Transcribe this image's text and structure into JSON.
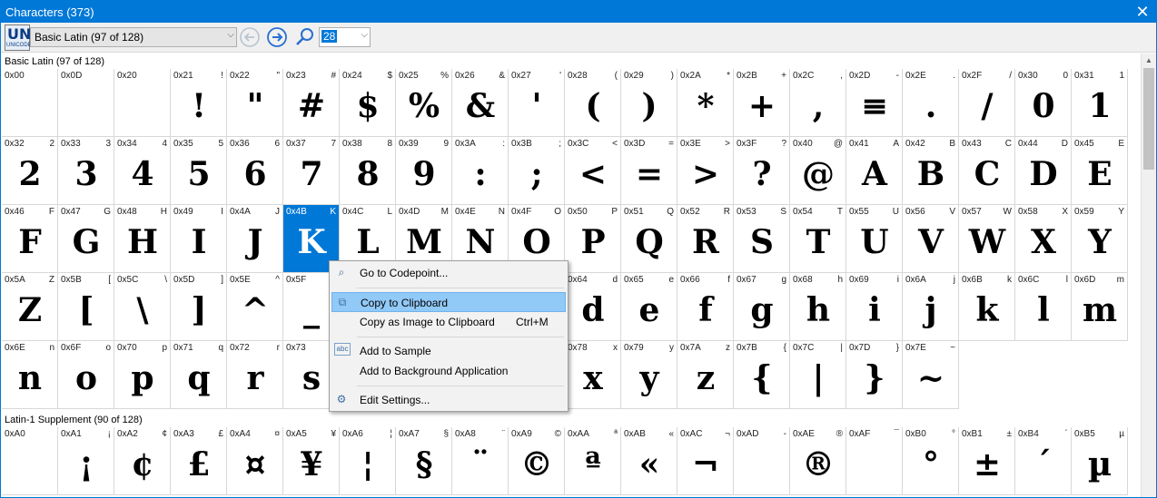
{
  "window": {
    "title": "Characters (373)",
    "close_glyph": "✕"
  },
  "toolbar": {
    "logo": {
      "text_top": "UN",
      "text_bottom": "UNICODE"
    },
    "block_select": "Basic Latin (97 of 128)",
    "size_select": "28",
    "back_icon": "back-arrow-icon",
    "forward_icon": "forward-arrow-icon",
    "search_icon": "search-icon"
  },
  "sections": [
    {
      "header": "Basic Latin (97 of 128)",
      "cells": [
        {
          "code": "0x00",
          "mini": "",
          "glyph": ""
        },
        {
          "code": "0x0D",
          "mini": "",
          "glyph": ""
        },
        {
          "code": "0x20",
          "mini": "",
          "glyph": ""
        },
        {
          "code": "0x21",
          "mini": "!",
          "glyph": "!"
        },
        {
          "code": "0x22",
          "mini": "\"",
          "glyph": "\""
        },
        {
          "code": "0x23",
          "mini": "#",
          "glyph": "#"
        },
        {
          "code": "0x24",
          "mini": "$",
          "glyph": "$"
        },
        {
          "code": "0x25",
          "mini": "%",
          "glyph": "%"
        },
        {
          "code": "0x26",
          "mini": "&",
          "glyph": "&"
        },
        {
          "code": "0x27",
          "mini": "'",
          "glyph": "'"
        },
        {
          "code": "0x28",
          "mini": "(",
          "glyph": "("
        },
        {
          "code": "0x29",
          "mini": ")",
          "glyph": ")"
        },
        {
          "code": "0x2A",
          "mini": "*",
          "glyph": "*"
        },
        {
          "code": "0x2B",
          "mini": "+",
          "glyph": "+"
        },
        {
          "code": "0x2C",
          "mini": ",",
          "glyph": ","
        },
        {
          "code": "0x2D",
          "mini": "-",
          "glyph": "≡"
        },
        {
          "code": "0x2E",
          "mini": ".",
          "glyph": "."
        },
        {
          "code": "0x2F",
          "mini": "/",
          "glyph": "/"
        },
        {
          "code": "0x30",
          "mini": "0",
          "glyph": "0"
        },
        {
          "code": "0x31",
          "mini": "1",
          "glyph": "1"
        },
        {
          "code": "0x32",
          "mini": "2",
          "glyph": "2"
        },
        {
          "code": "0x33",
          "mini": "3",
          "glyph": "3"
        },
        {
          "code": "0x34",
          "mini": "4",
          "glyph": "4"
        },
        {
          "code": "0x35",
          "mini": "5",
          "glyph": "5"
        },
        {
          "code": "0x36",
          "mini": "6",
          "glyph": "6"
        },
        {
          "code": "0x37",
          "mini": "7",
          "glyph": "7"
        },
        {
          "code": "0x38",
          "mini": "8",
          "glyph": "8"
        },
        {
          "code": "0x39",
          "mini": "9",
          "glyph": "9"
        },
        {
          "code": "0x3A",
          "mini": ":",
          "glyph": ":"
        },
        {
          "code": "0x3B",
          "mini": ";",
          "glyph": ";"
        },
        {
          "code": "0x3C",
          "mini": "<",
          "glyph": "<"
        },
        {
          "code": "0x3D",
          "mini": "=",
          "glyph": "="
        },
        {
          "code": "0x3E",
          "mini": ">",
          "glyph": ">"
        },
        {
          "code": "0x3F",
          "mini": "?",
          "glyph": "?"
        },
        {
          "code": "0x40",
          "mini": "@",
          "glyph": "@"
        },
        {
          "code": "0x41",
          "mini": "A",
          "glyph": "A"
        },
        {
          "code": "0x42",
          "mini": "B",
          "glyph": "B"
        },
        {
          "code": "0x43",
          "mini": "C",
          "glyph": "C"
        },
        {
          "code": "0x44",
          "mini": "D",
          "glyph": "D"
        },
        {
          "code": "0x45",
          "mini": "E",
          "glyph": "E"
        },
        {
          "code": "0x46",
          "mini": "F",
          "glyph": "F"
        },
        {
          "code": "0x47",
          "mini": "G",
          "glyph": "G"
        },
        {
          "code": "0x48",
          "mini": "H",
          "glyph": "H"
        },
        {
          "code": "0x49",
          "mini": "I",
          "glyph": "I"
        },
        {
          "code": "0x4A",
          "mini": "J",
          "glyph": "J"
        },
        {
          "code": "0x4B",
          "mini": "K",
          "glyph": "K",
          "selected": true
        },
        {
          "code": "0x4C",
          "mini": "L",
          "glyph": "L"
        },
        {
          "code": "0x4D",
          "mini": "M",
          "glyph": "M"
        },
        {
          "code": "0x4E",
          "mini": "N",
          "glyph": "N"
        },
        {
          "code": "0x4F",
          "mini": "O",
          "glyph": "O"
        },
        {
          "code": "0x50",
          "mini": "P",
          "glyph": "P"
        },
        {
          "code": "0x51",
          "mini": "Q",
          "glyph": "Q"
        },
        {
          "code": "0x52",
          "mini": "R",
          "glyph": "R"
        },
        {
          "code": "0x53",
          "mini": "S",
          "glyph": "S"
        },
        {
          "code": "0x54",
          "mini": "T",
          "glyph": "T"
        },
        {
          "code": "0x55",
          "mini": "U",
          "glyph": "U"
        },
        {
          "code": "0x56",
          "mini": "V",
          "glyph": "V"
        },
        {
          "code": "0x57",
          "mini": "W",
          "glyph": "W"
        },
        {
          "code": "0x58",
          "mini": "X",
          "glyph": "X"
        },
        {
          "code": "0x59",
          "mini": "Y",
          "glyph": "Y"
        },
        {
          "code": "0x5A",
          "mini": "Z",
          "glyph": "Z"
        },
        {
          "code": "0x5B",
          "mini": "[",
          "glyph": "["
        },
        {
          "code": "0x5C",
          "mini": "\\",
          "glyph": "\\"
        },
        {
          "code": "0x5D",
          "mini": "]",
          "glyph": "]"
        },
        {
          "code": "0x5E",
          "mini": "^",
          "glyph": "^"
        },
        {
          "code": "0x5F",
          "mini": "",
          "glyph": "_"
        },
        {
          "code": "",
          "mini": "",
          "glyph": ""
        },
        {
          "code": "",
          "mini": "",
          "glyph": ""
        },
        {
          "code": "",
          "mini": "",
          "glyph": ""
        },
        {
          "code": "",
          "mini": "",
          "glyph": ""
        },
        {
          "code": "0x64",
          "mini": "d",
          "glyph": "d"
        },
        {
          "code": "0x65",
          "mini": "e",
          "glyph": "e"
        },
        {
          "code": "0x66",
          "mini": "f",
          "glyph": "f"
        },
        {
          "code": "0x67",
          "mini": "g",
          "glyph": "g"
        },
        {
          "code": "0x68",
          "mini": "h",
          "glyph": "h"
        },
        {
          "code": "0x69",
          "mini": "i",
          "glyph": "i"
        },
        {
          "code": "0x6A",
          "mini": "j",
          "glyph": "j"
        },
        {
          "code": "0x6B",
          "mini": "k",
          "glyph": "k"
        },
        {
          "code": "0x6C",
          "mini": "l",
          "glyph": "l"
        },
        {
          "code": "0x6D",
          "mini": "m",
          "glyph": "m"
        },
        {
          "code": "0x6E",
          "mini": "n",
          "glyph": "n"
        },
        {
          "code": "0x6F",
          "mini": "o",
          "glyph": "o"
        },
        {
          "code": "0x70",
          "mini": "p",
          "glyph": "p"
        },
        {
          "code": "0x71",
          "mini": "q",
          "glyph": "q"
        },
        {
          "code": "0x72",
          "mini": "r",
          "glyph": "r"
        },
        {
          "code": "0x73",
          "mini": "",
          "glyph": "s"
        },
        {
          "code": "",
          "mini": "",
          "glyph": ""
        },
        {
          "code": "",
          "mini": "",
          "glyph": ""
        },
        {
          "code": "",
          "mini": "",
          "glyph": ""
        },
        {
          "code": "",
          "mini": "",
          "glyph": ""
        },
        {
          "code": "0x78",
          "mini": "x",
          "glyph": "x"
        },
        {
          "code": "0x79",
          "mini": "y",
          "glyph": "y"
        },
        {
          "code": "0x7A",
          "mini": "z",
          "glyph": "z"
        },
        {
          "code": "0x7B",
          "mini": "{",
          "glyph": "{"
        },
        {
          "code": "0x7C",
          "mini": "|",
          "glyph": "|"
        },
        {
          "code": "0x7D",
          "mini": "}",
          "glyph": "}"
        },
        {
          "code": "0x7E",
          "mini": "~",
          "glyph": "~"
        }
      ]
    },
    {
      "header": "Latin-1 Supplement (90 of 128)",
      "cells": [
        {
          "code": "0xA0",
          "mini": "",
          "glyph": ""
        },
        {
          "code": "0xA1",
          "mini": "¡",
          "glyph": "¡"
        },
        {
          "code": "0xA2",
          "mini": "¢",
          "glyph": "¢"
        },
        {
          "code": "0xA3",
          "mini": "£",
          "glyph": "£"
        },
        {
          "code": "0xA4",
          "mini": "¤",
          "glyph": "¤"
        },
        {
          "code": "0xA5",
          "mini": "¥",
          "glyph": "¥"
        },
        {
          "code": "0xA6",
          "mini": "¦",
          "glyph": "¦"
        },
        {
          "code": "0xA7",
          "mini": "§",
          "glyph": "§"
        },
        {
          "code": "0xA8",
          "mini": "¨",
          "glyph": "¨"
        },
        {
          "code": "0xA9",
          "mini": "©",
          "glyph": "©"
        },
        {
          "code": "0xAA",
          "mini": "ª",
          "glyph": "ª"
        },
        {
          "code": "0xAB",
          "mini": "«",
          "glyph": "«"
        },
        {
          "code": "0xAC",
          "mini": "¬",
          "glyph": "¬"
        },
        {
          "code": "0xAD",
          "mini": "-",
          "glyph": ""
        },
        {
          "code": "0xAE",
          "mini": "®",
          "glyph": "®"
        },
        {
          "code": "0xAF",
          "mini": "¯",
          "glyph": ""
        },
        {
          "code": "0xB0",
          "mini": "°",
          "glyph": "°"
        },
        {
          "code": "0xB1",
          "mini": "±",
          "glyph": "±"
        },
        {
          "code": "0xB4",
          "mini": "´",
          "glyph": "´"
        },
        {
          "code": "0xB5",
          "mini": "µ",
          "glyph": "µ"
        }
      ]
    }
  ],
  "context_menu": {
    "items": [
      {
        "label": "Go to Codepoint...",
        "shortcut": "",
        "icon": "search-icon",
        "icon_glyph": "⌕"
      },
      {
        "label": "Copy to Clipboard",
        "shortcut": "",
        "icon": "copy-icon",
        "icon_glyph": "⧉",
        "highlighted": true
      },
      {
        "label": "Copy as Image to Clipboard",
        "shortcut": "Ctrl+M",
        "icon": "",
        "icon_glyph": ""
      },
      {
        "label": "Add to Sample",
        "shortcut": "",
        "icon": "sample-icon",
        "icon_glyph": "abc"
      },
      {
        "label": "Add to Background Application",
        "shortcut": "",
        "icon": "",
        "icon_glyph": ""
      },
      {
        "label": "Edit Settings...",
        "shortcut": "",
        "icon": "settings-icon",
        "icon_glyph": "⚙"
      }
    ]
  }
}
